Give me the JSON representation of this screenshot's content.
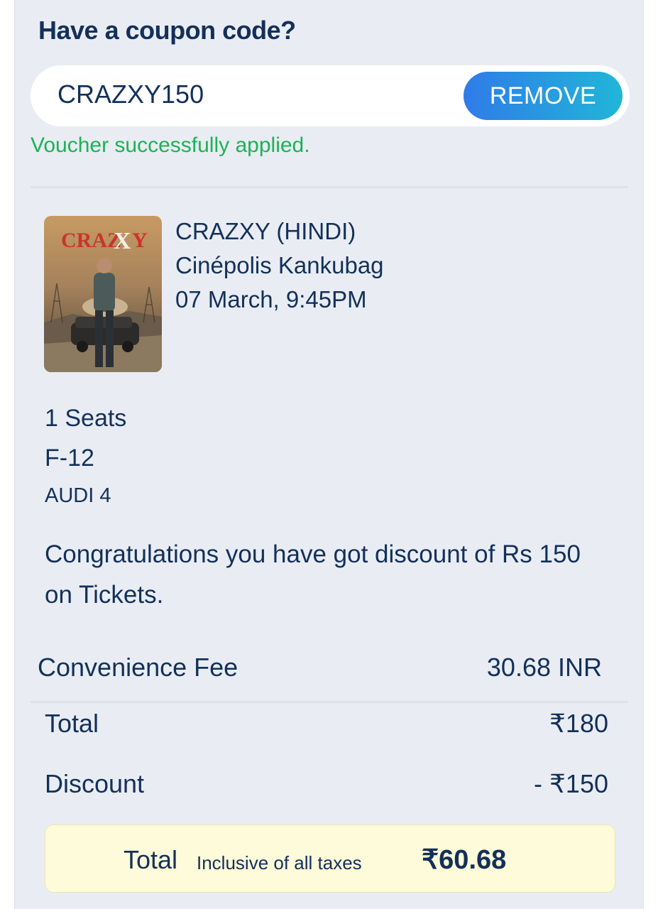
{
  "coupon": {
    "heading": "Have a coupon code?",
    "code": "CRAZXY150",
    "remove_label": "REMOVE",
    "success_message": "Voucher successfully applied."
  },
  "movie": {
    "poster_title": "CRAZXY",
    "title": "CRAZXY (HINDI)",
    "cinema": "Cinépolis Kankubag",
    "showtime": "07 March, 9:45PM"
  },
  "booking": {
    "seat_count": "1 Seats",
    "seat_number": "F-12",
    "audi": "AUDI 4"
  },
  "discount_message": "Congratulations you have got discount of Rs 150 on Tickets.",
  "summary": {
    "convenience_fee_label": "Convenience Fee",
    "convenience_fee_value": "30.68 INR",
    "total_label": "Total",
    "total_value": "₹180",
    "discount_label": "Discount",
    "discount_value": "- ₹150"
  },
  "grand_total": {
    "label": "Total",
    "sublabel": "Inclusive of all taxes",
    "value": "₹60.68"
  },
  "colors": {
    "heading": "#13305a",
    "success": "#1db255",
    "button_gradient_start": "#2f7be8",
    "button_gradient_end": "#21b6d8",
    "total_box": "#fdfbd9",
    "background": "#e9edf3"
  }
}
